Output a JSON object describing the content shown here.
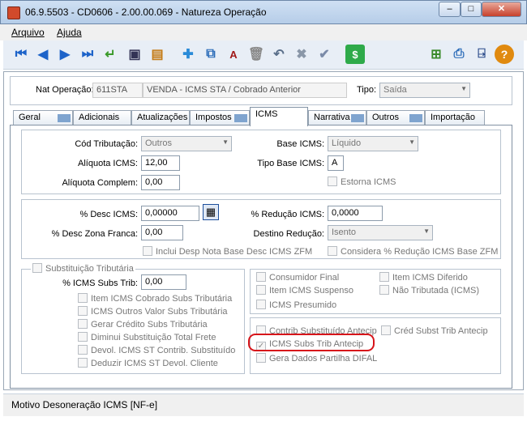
{
  "window": {
    "title": "06.9.5503 - CD0606 - 2.00.00.069 - Natureza Operação"
  },
  "menu": [
    "Arquivo",
    "Ajuda"
  ],
  "toolbar_icons": [
    "first-icon",
    "prev-icon",
    "next-icon",
    "last-icon",
    "enter-icon",
    "view-icon",
    "report-icon",
    "new-icon",
    "copy-icon",
    "text-icon",
    "delete-icon",
    "undo-icon",
    "cancel-icon",
    "confirm-icon",
    "dollar-icon",
    "tree-icon",
    "print-icon",
    "exit-icon",
    "help-icon"
  ],
  "header": {
    "nat_label": "Nat Operação:",
    "nat_code": "611STA",
    "nat_desc": "VENDA - ICMS STA / Cobrado Anterior",
    "tipo_label": "Tipo:",
    "tipo_value": "Saída"
  },
  "tabs": [
    "Geral",
    "Adicionais",
    "Atualizações",
    "Impostos",
    "ICMS",
    "Narrativa",
    "Outros",
    "Importação"
  ],
  "icms": {
    "cod_trib_label": "Cód Tributação:",
    "cod_trib_value": "Outros",
    "aliquota_label": "Alíquota ICMS:",
    "aliquota_value": "12,00",
    "aliq_compl_label": "Alíquota Complem:",
    "aliq_compl_value": "0,00",
    "base_label": "Base ICMS:",
    "base_value": "Líquido",
    "tipo_base_label": "Tipo Base ICMS:",
    "tipo_base_value": "A",
    "estorna_label": "Estorna ICMS"
  },
  "desc": {
    "pct_desc_label": "% Desc ICMS:",
    "pct_desc_value": "0,00000",
    "zona_label": "% Desc Zona Franca:",
    "zona_value": "0,00",
    "red_label": "% Redução ICMS:",
    "red_value": "0,0000",
    "dest_label": "Destino Redução:",
    "dest_value": "Isento",
    "inclui_label": "Inclui Desp Nota Base Desc ICMS ZFM",
    "considera_label": "Considera % Redução ICMS Base ZFM"
  },
  "subst": {
    "group_label": "Substituição Tributária",
    "pct_label": "% ICMS Subs Trib:",
    "pct_value": "0,00",
    "checks": [
      "Item ICMS Cobrado Subs Tributária",
      "ICMS Outros Valor Subs Tributária",
      "Gerar Crédito Subs Tributária",
      "Diminui Substituição Total Frete",
      "Devol. ICMS ST Contrib. Substituído",
      "Deduzir ICMS ST Devol. Cliente"
    ]
  },
  "flags_left": [
    "Consumidor Final",
    "Item ICMS Suspenso",
    "ICMS Presumido"
  ],
  "flags_right": [
    "Item ICMS Diferido",
    "Não Tributada (ICMS)"
  ],
  "antecip": {
    "contrib": "Contrib Substituído Antecip",
    "cred": "Créd Subst Trib Antecip",
    "icms": "ICMS Subs Trib Antecip",
    "difal": "Gera Dados Partilha DIFAL"
  },
  "status": "Motivo Desoneração ICMS [NF-e]"
}
